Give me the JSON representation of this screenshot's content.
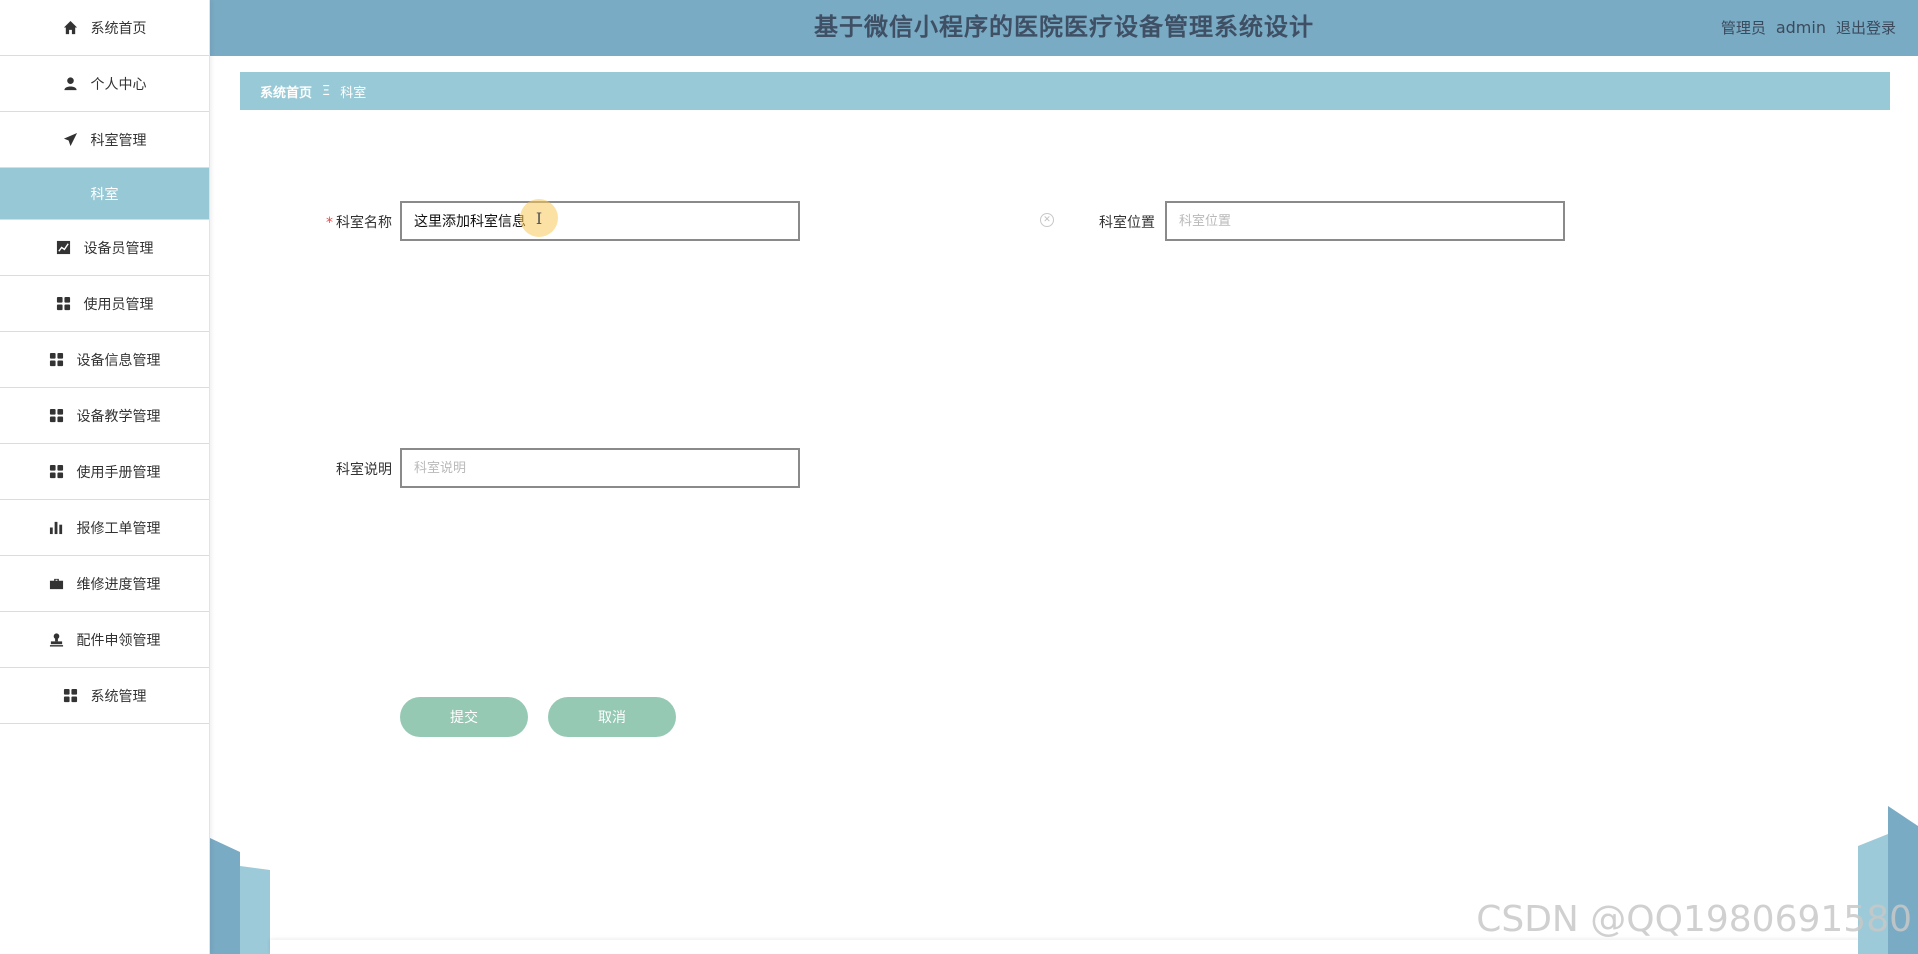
{
  "app": {
    "title": "基于微信小程序的医院医疗设备管理系统设计",
    "user_role": "管理员",
    "user_name": "admin",
    "logout_label": "退出登录"
  },
  "sidebar": {
    "items": [
      {
        "label": "系统首页",
        "icon": "home-icon"
      },
      {
        "label": "个人中心",
        "icon": "user-icon"
      },
      {
        "label": "科室管理",
        "icon": "send-icon"
      },
      {
        "label": "科室",
        "icon": "",
        "active_sub": true
      },
      {
        "label": "设备员管理",
        "icon": "chart-line-icon"
      },
      {
        "label": "使用员管理",
        "icon": "grid-icon"
      },
      {
        "label": "设备信息管理",
        "icon": "grid-icon"
      },
      {
        "label": "设备教学管理",
        "icon": "grid-icon"
      },
      {
        "label": "使用手册管理",
        "icon": "grid-icon"
      },
      {
        "label": "报修工单管理",
        "icon": "bar-chart-icon"
      },
      {
        "label": "维修进度管理",
        "icon": "briefcase-icon"
      },
      {
        "label": "配件申领管理",
        "icon": "stamp-icon"
      },
      {
        "label": "系统管理",
        "icon": "grid-icon"
      }
    ]
  },
  "breadcrumb": {
    "home": "系统首页",
    "separator": "Ξ",
    "current": "科室"
  },
  "form": {
    "name_label": "科室名称",
    "name_required_mark": "*",
    "name_value": "这里添加科室信息",
    "location_label": "科室位置",
    "location_placeholder": "科室位置",
    "desc_label": "科室说明",
    "desc_placeholder": "科室说明",
    "submit_label": "提交",
    "cancel_label": "取消"
  },
  "watermark": "CSDN @QQ1980691580",
  "colors": {
    "header_bg": "#7aabc4",
    "breadcrumb_bg": "#98c9d6",
    "active_sub_bg": "#96c8d6",
    "button_bg": "#95c9b4"
  }
}
